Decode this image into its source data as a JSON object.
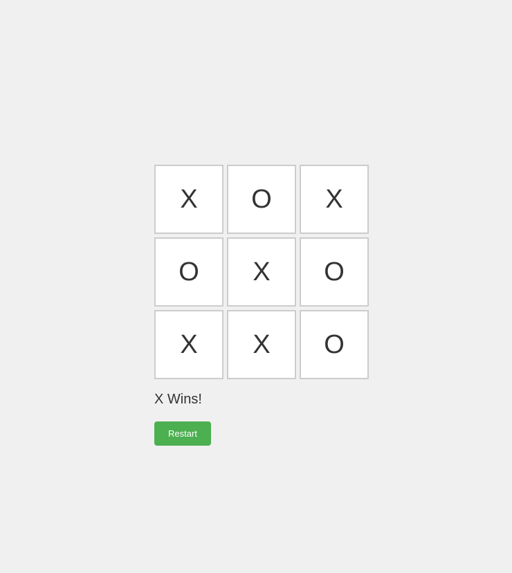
{
  "board": {
    "cells": [
      {
        "value": "X"
      },
      {
        "value": "O"
      },
      {
        "value": "X"
      },
      {
        "value": "O"
      },
      {
        "value": "X"
      },
      {
        "value": "O"
      },
      {
        "value": "X"
      },
      {
        "value": "X"
      },
      {
        "value": "O"
      }
    ]
  },
  "status": {
    "text": "X Wins!"
  },
  "controls": {
    "restart_label": "Restart"
  },
  "colors": {
    "background": "#f0f0f0",
    "cell_background": "#ffffff",
    "cell_border": "#cccccc",
    "text": "#333333",
    "button": "#4caf50",
    "button_text": "#ffffff"
  }
}
